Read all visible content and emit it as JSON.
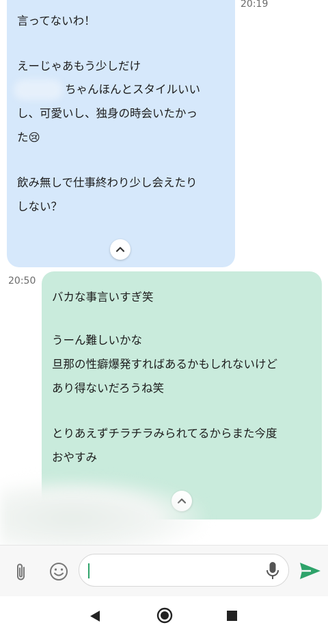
{
  "incoming": {
    "time": "20:19",
    "lines": [
      "言ってないわ！",
      "",
      "えーじゃあもう少しだけ",
      "ちゃんほんとスタイルいい",
      "し、可愛いし、独身の時会いたかっ",
      "た😢",
      "",
      "飲み無しで仕事終わり少し会えたり",
      "しない？"
    ]
  },
  "outgoing": {
    "time": "20:50",
    "lines": [
      "バカな事言いすぎ笑",
      "",
      "うーん難しいかな",
      "旦那の性癖爆発すればあるかもしれないけど",
      "あり得ないだろうね笑",
      "",
      "とりあえずチラチラみられてるからまた今度",
      "おやすみ"
    ]
  },
  "composer": {
    "value": ""
  },
  "colors": {
    "incoming_bubble": "#d6e8fb",
    "outgoing_bubble": "#c9ebdc",
    "accent": "#2ea36a"
  },
  "icons": {
    "attach": "paperclip-icon",
    "emoji": "smiley-icon",
    "mic": "microphone-icon",
    "send": "send-icon",
    "collapse": "chevron-up-icon"
  }
}
